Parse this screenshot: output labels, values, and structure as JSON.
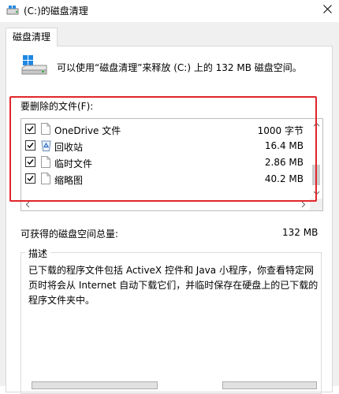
{
  "window": {
    "title": "(C:)的磁盘清理"
  },
  "tabs": [
    {
      "label": "磁盘清理"
    }
  ],
  "summary": {
    "text": "可以使用“磁盘清理”来释放  (C:) 上的 132 MB 磁盘空间。"
  },
  "files_to_delete": {
    "label": "要删除的文件(F):",
    "items": [
      {
        "name": "OneDrive 文件",
        "size": "1000 字节",
        "checked": true,
        "icon": "file-icon"
      },
      {
        "name": "回收站",
        "size": "16.4 MB",
        "checked": true,
        "icon": "recycle-bin-icon"
      },
      {
        "name": "临时文件",
        "size": "2.86 MB",
        "checked": true,
        "icon": "file-icon"
      },
      {
        "name": "缩略图",
        "size": "40.2 MB",
        "checked": true,
        "icon": "file-icon"
      }
    ]
  },
  "total": {
    "label": "可获得的磁盘空间总量:",
    "value": "132 MB"
  },
  "description": {
    "legend": "描述",
    "text": "已下载的程序文件包括 ActiveX 控件和 Java 小程序，你查看特定网页时将会从 Internet 自动下载它们，并临时保存在硬盘上的已下载的程序文件夹中。"
  },
  "colors": {
    "highlight_border": "#e0262b",
    "window_background": "#f0f0f0"
  }
}
